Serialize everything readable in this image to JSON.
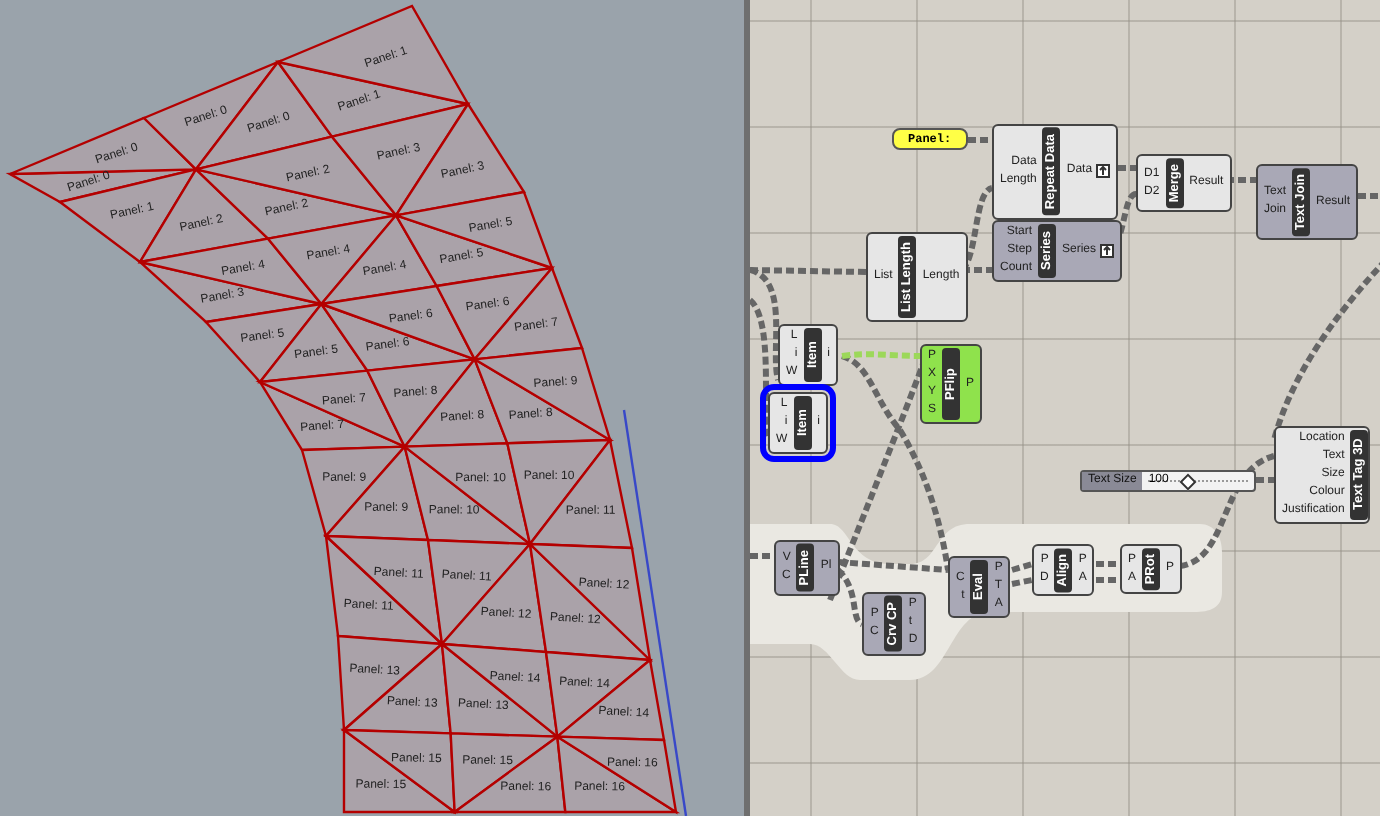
{
  "viewport": {
    "panel_labels": [
      "Panel: 0",
      "Panel: 0",
      "Panel: 0",
      "Panel: 0",
      "Panel: 1",
      "Panel: 1",
      "Panel: 1",
      "Panel: 2",
      "Panel: 2",
      "Panel: 2",
      "Panel: 3",
      "Panel: 3",
      "Panel: 3",
      "Panel: 4",
      "Panel: 4",
      "Panel: 4",
      "Panel: 5",
      "Panel: 5",
      "Panel: 5",
      "Panel: 5",
      "Panel: 6",
      "Panel: 6",
      "Panel: 6",
      "Panel: 7",
      "Panel: 7",
      "Panel: 7",
      "Panel: 8",
      "Panel: 8",
      "Panel: 8",
      "Panel: 9",
      "Panel: 9",
      "Panel: 9",
      "Panel: 10",
      "Panel: 10",
      "Panel: 10",
      "Panel: 11",
      "Panel: 11",
      "Panel: 11",
      "Panel: 11",
      "Panel: 12",
      "Panel: 12",
      "Panel: 12",
      "Panel: 13",
      "Panel: 13",
      "Panel: 13",
      "Panel: 14",
      "Panel: 14",
      "Panel: 14",
      "Panel: 15",
      "Panel: 15",
      "Panel: 15",
      "Panel: 16",
      "Panel: 16",
      "Panel: 16"
    ]
  },
  "nodes": [
    {
      "kind": "panel",
      "text": "Panel:"
    },
    {
      "kind": "component",
      "name": "Repeat Data",
      "color": "#e6e6e6",
      "selected": false,
      "graft_output": true,
      "inputs": [
        "Data",
        "Length"
      ],
      "outputs": [
        "Data"
      ]
    },
    {
      "kind": "component",
      "name": "Series",
      "color": "#a9a8b6",
      "selected": false,
      "graft_output": true,
      "inputs": [
        "Start",
        "Step",
        "Count"
      ],
      "outputs": [
        "Series"
      ]
    },
    {
      "kind": "component",
      "name": "List Length",
      "color": "#e6e6e6",
      "selected": false,
      "graft_output": false,
      "inputs": [
        "List"
      ],
      "outputs": [
        "Length"
      ]
    },
    {
      "kind": "component",
      "name": "Merge",
      "color": "#e6e6e6",
      "selected": false,
      "graft_output": false,
      "inputs": [
        "D1",
        "D2"
      ],
      "outputs": [
        "Result"
      ]
    },
    {
      "kind": "component",
      "name": "Text Join",
      "color": "#a9a8b6",
      "selected": false,
      "graft_output": false,
      "inputs": [
        "Text",
        "Join"
      ],
      "outputs": [
        "Result"
      ]
    },
    {
      "kind": "component",
      "name": "Item",
      "color": "#e6e6e6",
      "selected": false,
      "graft_output": false,
      "inputs": [
        "L",
        "i",
        "W"
      ],
      "outputs": [
        "i"
      ]
    },
    {
      "kind": "component",
      "name": "Item",
      "color": "#e6e6e6",
      "selected": true,
      "graft_output": false,
      "inputs": [
        "L",
        "i",
        "W"
      ],
      "outputs": [
        "i"
      ]
    },
    {
      "kind": "component",
      "name": "PFlip",
      "color": "#8fe24c",
      "selected": false,
      "graft_output": false,
      "inputs": [
        "P",
        "X",
        "Y",
        "S"
      ],
      "outputs": [
        "P"
      ]
    },
    {
      "kind": "slider",
      "label": "Text Size",
      "value": "100"
    },
    {
      "kind": "component",
      "name": "Text Tag 3D",
      "color": "#e6e6e6",
      "selected": false,
      "inputs": [
        "Location",
        "Text",
        "Size",
        "Colour",
        "Justification"
      ]
    },
    {
      "kind": "component",
      "name": "PLine",
      "color": "#a9a8b6",
      "selected": false,
      "graft_output": false,
      "inputs": [
        "V",
        "C"
      ],
      "outputs": [
        "Pl"
      ]
    },
    {
      "kind": "component",
      "name": "Crv CP",
      "color": "#a9a8b6",
      "selected": false,
      "graft_output": false,
      "inputs": [
        "P",
        "C"
      ],
      "outputs": [
        "P",
        "t",
        "D"
      ]
    },
    {
      "kind": "component",
      "name": "Eval",
      "color": "#a9a8b6",
      "selected": false,
      "graft_output": false,
      "inputs": [
        "C",
        "t"
      ],
      "outputs": [
        "P",
        "T",
        "A"
      ]
    },
    {
      "kind": "component",
      "name": "Align",
      "color": "#e6e6e6",
      "selected": false,
      "graft_output": false,
      "inputs": [
        "P",
        "D"
      ],
      "outputs": [
        "P",
        "A"
      ]
    },
    {
      "kind": "component",
      "name": "PRot",
      "color": "#e6e6e6",
      "selected": false,
      "graft_output": false,
      "inputs": [
        "P",
        "A"
      ],
      "outputs": [
        "P"
      ]
    }
  ]
}
